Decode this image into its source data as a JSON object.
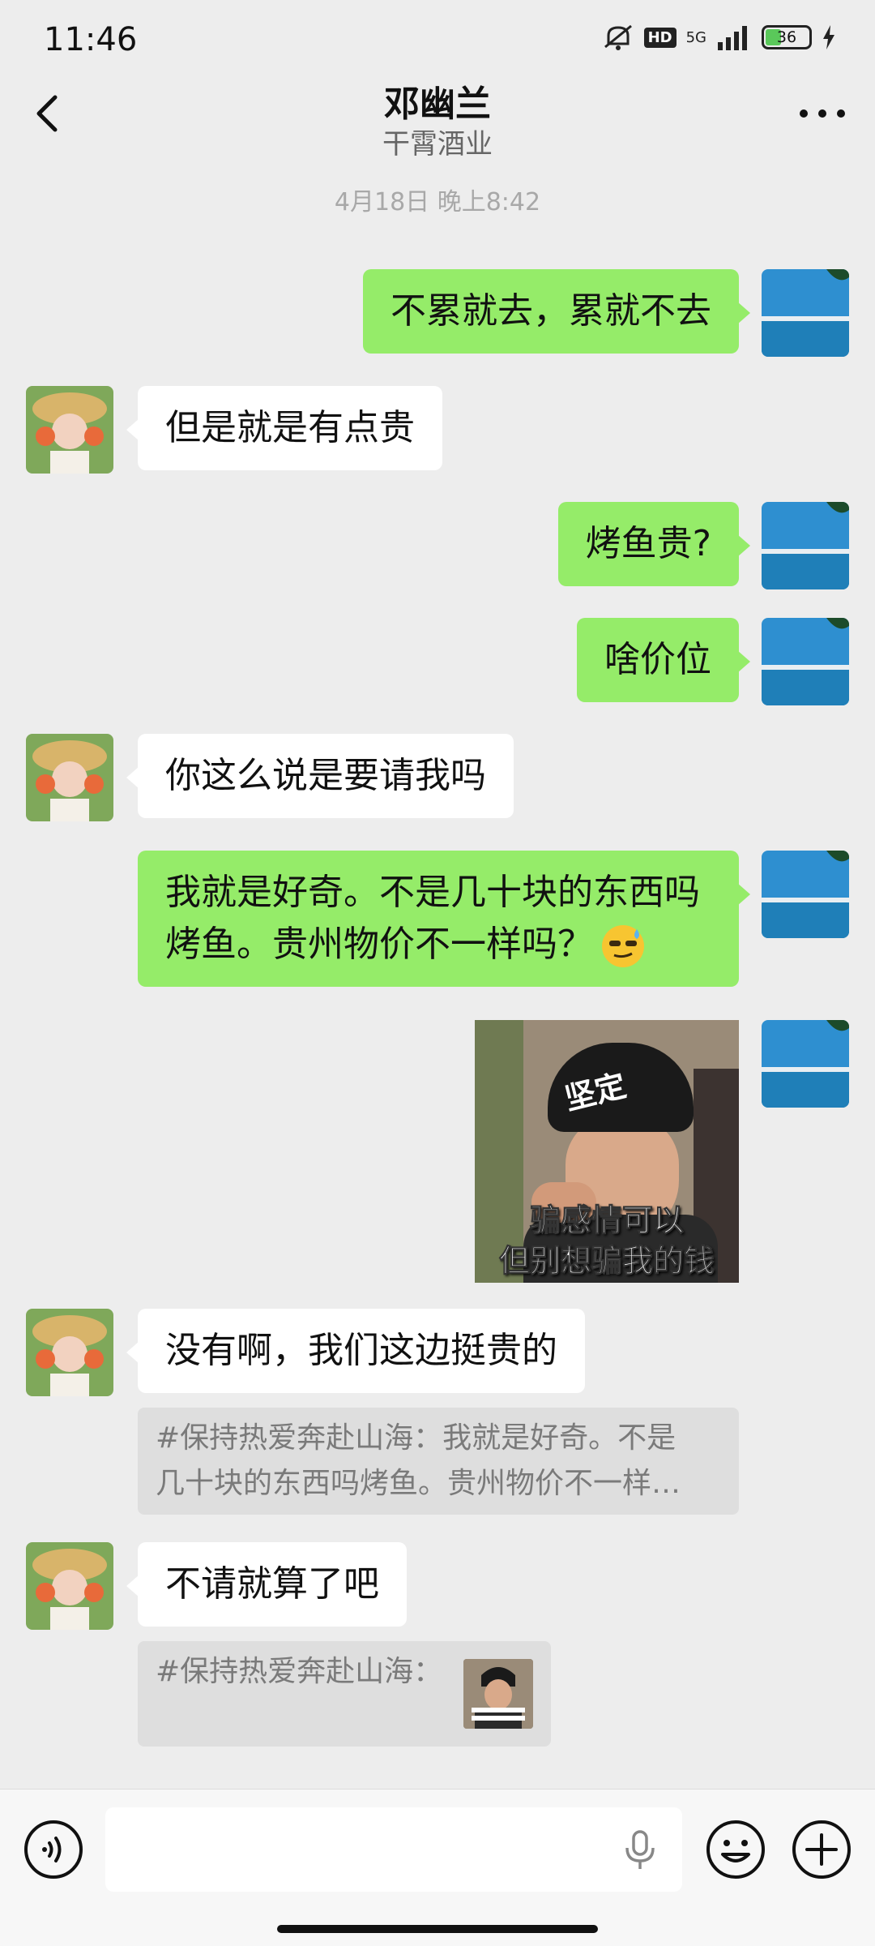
{
  "status_bar": {
    "time": "11:46",
    "hd": "HD",
    "network": "5G",
    "battery": "36",
    "battery_level": 0.36
  },
  "header": {
    "name": "邓幽兰",
    "org": "干霄酒业"
  },
  "timestamp": "4月18日 晚上8:42",
  "messages": [
    {
      "side": "mine",
      "text": "不累就去，累就不去"
    },
    {
      "side": "theirs",
      "text": "但是就是有点贵"
    },
    {
      "side": "mine",
      "text": "烤鱼贵?"
    },
    {
      "side": "mine",
      "text": "啥价位"
    },
    {
      "side": "theirs",
      "text": "你这么说是要请我吗"
    },
    {
      "side": "mine",
      "lines": [
        "我就是好奇。不是几十块的东西吗",
        "烤鱼。贵州物价不一样吗？"
      ],
      "emoji": "sweat-cool-emoji"
    },
    {
      "side": "mine",
      "sticker": {
        "cap_text": "坚定",
        "caption_lines": [
          "骗感情可以",
          "但别想骗我的钱"
        ]
      }
    },
    {
      "side": "theirs",
      "text": "没有啊，我们这边挺贵的"
    },
    {
      "side": "theirs",
      "text": "不请就算了吧"
    }
  ],
  "quotes": [
    {
      "lines": [
        "#保持热爱奔赴山海：我就是好奇。不是",
        "几十块的东西吗烤鱼。贵州物价不一样…"
      ]
    },
    {
      "lines": [
        "#保持热爱奔赴山海："
      ],
      "thumb": true
    }
  ],
  "input": {
    "placeholder": ""
  },
  "colors": {
    "background": "#ededed",
    "mine_bubble": "#95ec69",
    "theirs_bubble": "#ffffff",
    "quote_bg": "#dedede"
  }
}
